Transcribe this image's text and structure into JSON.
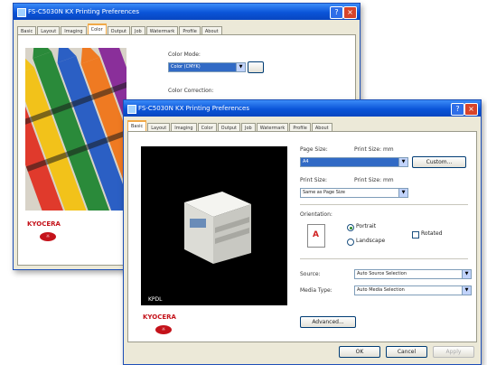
{
  "back_window": {
    "title": "FS-C5030N KX Printing Preferences",
    "tabs": [
      "Basic",
      "Layout",
      "Imaging",
      "Color",
      "Output",
      "Job",
      "Watermark",
      "Profile",
      "About"
    ],
    "active_tab": "Color",
    "color_mode_label": "Color Mode:",
    "color_mode_value": "Color (CMYK)",
    "color_correction_label": "Color Correction:",
    "brand_logo": "KYOCERA"
  },
  "front_window": {
    "title": "FS-C5030N KX Printing Preferences",
    "tabs": [
      "Basic",
      "Layout",
      "Imaging",
      "Color",
      "Output",
      "Job",
      "Watermark",
      "Profile",
      "About"
    ],
    "active_tab": "Basic",
    "page_size_label": "Page Size:",
    "page_size_units": "Print Size: mm",
    "page_size_value": "A4",
    "custom_button": "Custom...",
    "print_size_label": "Print Size:",
    "print_size_units": "Print Size: mm",
    "print_size_value": "Same as Page Size",
    "orientation_label": "Orientation:",
    "portrait_label": "Portrait",
    "landscape_label": "Landscape",
    "rotated_label": "Rotated",
    "source_label": "Source:",
    "source_value": "Auto Source Selection",
    "media_type_label": "Media Type:",
    "media_type_value": "Auto Media Selection",
    "advanced_button": "Advanced...",
    "printer_label": "KPDL",
    "brand_logo": "KYOCERA",
    "ok_button": "OK",
    "cancel_button": "Cancel",
    "apply_button": "Apply"
  },
  "colors": {
    "titlebar": "#0a54d8",
    "dialog_bg": "#ece9d8",
    "selection": "#316ac5",
    "brand_red": "#c4121a"
  }
}
